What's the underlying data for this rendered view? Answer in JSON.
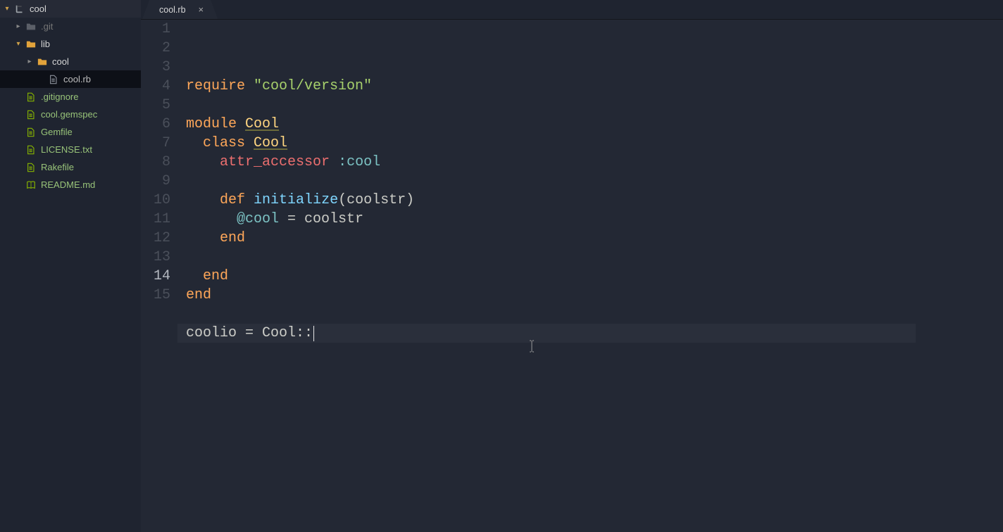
{
  "sidebar": {
    "root": "cool",
    "items": [
      {
        "label": ".git",
        "type": "folder",
        "open": false,
        "indent": 1,
        "dim": true,
        "arrow": "right"
      },
      {
        "label": "lib",
        "type": "folder",
        "open": true,
        "indent": 1,
        "dim": false,
        "arrow": "down",
        "openClr": true
      },
      {
        "label": "cool",
        "type": "folder",
        "open": false,
        "indent": 2,
        "dim": false,
        "arrow": "right",
        "openClr": true
      },
      {
        "label": "cool.rb",
        "type": "file",
        "indent": 3,
        "selected": true
      },
      {
        "label": ".gitignore",
        "type": "file",
        "indent": 1,
        "green": true
      },
      {
        "label": "cool.gemspec",
        "type": "file",
        "indent": 1,
        "green": true
      },
      {
        "label": "Gemfile",
        "type": "file",
        "indent": 1,
        "green": true
      },
      {
        "label": "LICENSE.txt",
        "type": "file",
        "indent": 1,
        "green": true
      },
      {
        "label": "Rakefile",
        "type": "file",
        "indent": 1,
        "green": true
      },
      {
        "label": "README.md",
        "type": "book",
        "indent": 1,
        "green": true
      }
    ]
  },
  "tab": {
    "title": "cool.rb"
  },
  "code": {
    "currentLine": 14,
    "lines": [
      {
        "n": 1,
        "tokens": [
          [
            "kw",
            "require"
          ],
          [
            "punc",
            " "
          ],
          [
            "str",
            "\"cool/version\""
          ]
        ]
      },
      {
        "n": 2,
        "tokens": []
      },
      {
        "n": 3,
        "tokens": [
          [
            "kw",
            "module"
          ],
          [
            "punc",
            " "
          ],
          [
            "cls",
            "Cool"
          ]
        ]
      },
      {
        "n": 4,
        "tokens": [
          [
            "punc",
            "  "
          ],
          [
            "kw",
            "class"
          ],
          [
            "punc",
            " "
          ],
          [
            "cls",
            "Cool"
          ]
        ]
      },
      {
        "n": 5,
        "tokens": [
          [
            "punc",
            "    "
          ],
          [
            "kw2",
            "attr_accessor"
          ],
          [
            "punc",
            " "
          ],
          [
            "sym",
            ":cool"
          ]
        ]
      },
      {
        "n": 6,
        "tokens": []
      },
      {
        "n": 7,
        "tokens": [
          [
            "punc",
            "    "
          ],
          [
            "kw",
            "def"
          ],
          [
            "punc",
            " "
          ],
          [
            "fn",
            "initialize"
          ],
          [
            "punc",
            "("
          ],
          [
            "id",
            "coolstr"
          ],
          [
            "punc",
            ")"
          ]
        ]
      },
      {
        "n": 8,
        "tokens": [
          [
            "punc",
            "      "
          ],
          [
            "ivar",
            "@cool"
          ],
          [
            "punc",
            " = "
          ],
          [
            "id",
            "coolstr"
          ]
        ]
      },
      {
        "n": 9,
        "tokens": [
          [
            "punc",
            "    "
          ],
          [
            "kw",
            "end"
          ]
        ]
      },
      {
        "n": 10,
        "tokens": []
      },
      {
        "n": 11,
        "tokens": [
          [
            "punc",
            "  "
          ],
          [
            "kw",
            "end"
          ]
        ]
      },
      {
        "n": 12,
        "tokens": [
          [
            "kw",
            "end"
          ]
        ]
      },
      {
        "n": 13,
        "tokens": []
      },
      {
        "n": 14,
        "tokens": [
          [
            "id",
            "coolio"
          ],
          [
            "punc",
            " = "
          ],
          [
            "clsP",
            "Cool"
          ],
          [
            "punc",
            "::"
          ]
        ],
        "cursor": true
      },
      {
        "n": 15,
        "tokens": []
      }
    ]
  }
}
